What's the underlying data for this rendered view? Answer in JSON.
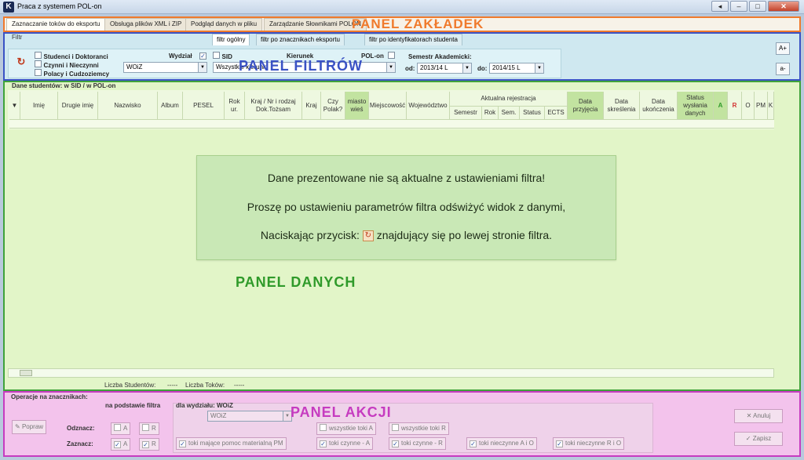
{
  "window": {
    "title": "Praca z systemem POL-on"
  },
  "tabs": [
    "Zaznaczanie toków do eksportu",
    "Obsługa plików XML i ZIP",
    "Podgląd danych w pliku",
    "Zarządzanie Słownikami POLON"
  ],
  "panel_labels": {
    "tabs": "PANEL ZAKŁADEK",
    "filters": "PANEL FILTRÓW",
    "data": "PANEL DANYCH",
    "actions": "PANEL AKCJI"
  },
  "filter": {
    "label": "Filtr",
    "subtabs": [
      "filtr ogólny",
      "filtr po znacznikach eksportu",
      "filtr po identyfikatorach studenta"
    ],
    "checkboxes": [
      "Studenci i Doktoranci",
      "Czynni i Nieczynni",
      "Polacy i Cudzoziemcy"
    ],
    "wydzial_label": "Wydział",
    "wydzial_value": "WOiZ",
    "sid_label": "SID",
    "kierunek_label": "Kierunek",
    "kierunek_value": "Wszystkie kierunki",
    "polon_label": "POL-on",
    "semestr_label": "Semestr Akademicki:",
    "od_label": "od:",
    "od_value": "2013/14 L",
    "do_label": "do:",
    "do_value": "2014/15 L",
    "font_up": "A+",
    "font_down": "a-"
  },
  "data_panel": {
    "title": "Dane studentów: w SID / w POL-on",
    "columns": [
      "Imię",
      "Drugie imię",
      "Nazwisko",
      "Album",
      "PESEL",
      "Rok ur.",
      "Kraj / Nr i rodzaj Dok.Tożsam",
      "Kraj",
      "Czy Polak?",
      "miasto wieś",
      "Miejscowość",
      "Województwo"
    ],
    "group_header": "Aktualna rejestracja",
    "group_columns": [
      "Semestr",
      "Rok",
      "Sem.",
      "Status",
      "ECTS"
    ],
    "tail_columns": [
      "Data przyjęcia",
      "Data skreślenia",
      "Data ukończenia",
      "Status wysłania danych",
      "A",
      "R",
      "O",
      "PM",
      "K"
    ],
    "notice": [
      "Dane prezentowane nie są aktualne z ustawieniami filtra!",
      "Proszę po ustawieniu parametrów filtra odświżyć widok z danymi,",
      "Naciskając przycisk:",
      "znajdujący się po lewej stronie filtra."
    ],
    "status_students_label": "Liczba Studentów:",
    "status_students_value": "-----",
    "status_tokens_label": "Liczba Toków:",
    "status_tokens_value": "-----"
  },
  "actions": {
    "title": "Operacje na znacznikach:",
    "basis_label": "na podstawie filtra",
    "faculty_label": "dla wydziału: WOiZ",
    "faculty_value": "WOiZ",
    "popraw": "Popraw",
    "odznacz": "Odznacz:",
    "zaznacz": "Zaznacz:",
    "a": "A",
    "r": "R",
    "all_a": "wszystkie toki A",
    "all_r": "wszystkie toki R",
    "pm": "toki mające pomoc materialną PM",
    "active_a": "toki czynne - A",
    "active_r": "toki czynne - R",
    "inactive_ao": "toki nieczynne A i O",
    "inactive_ro": "toki nieczynne R i O",
    "anuluj": "Anuluj",
    "zapisz": "Zapisz"
  },
  "colors": {
    "tabs_accent": "#f07a2c",
    "filters_accent": "#3a52c4",
    "data_accent": "#3fa23a",
    "actions_accent": "#c63bc0"
  }
}
